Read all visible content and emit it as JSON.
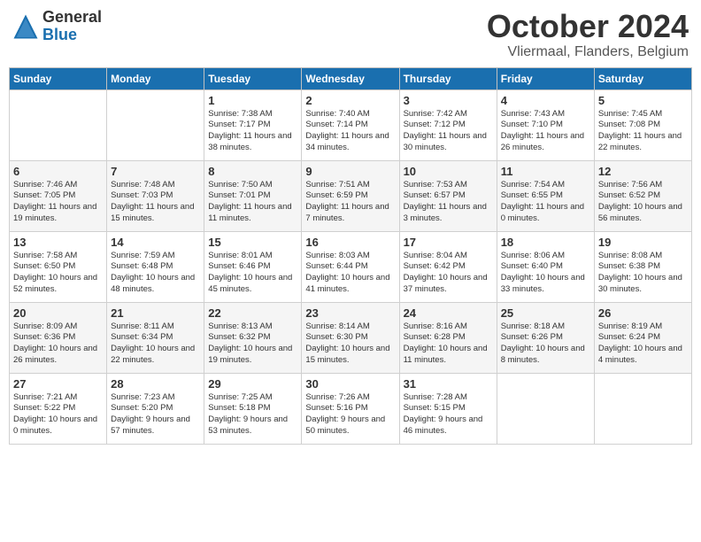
{
  "header": {
    "logo_general": "General",
    "logo_blue": "Blue",
    "month_title": "October 2024",
    "location": "Vliermaal, Flanders, Belgium"
  },
  "weekdays": [
    "Sunday",
    "Monday",
    "Tuesday",
    "Wednesday",
    "Thursday",
    "Friday",
    "Saturday"
  ],
  "weeks": [
    [
      {
        "day": "",
        "sunrise": "",
        "sunset": "",
        "daylight": ""
      },
      {
        "day": "",
        "sunrise": "",
        "sunset": "",
        "daylight": ""
      },
      {
        "day": "1",
        "sunrise": "Sunrise: 7:38 AM",
        "sunset": "Sunset: 7:17 PM",
        "daylight": "Daylight: 11 hours and 38 minutes."
      },
      {
        "day": "2",
        "sunrise": "Sunrise: 7:40 AM",
        "sunset": "Sunset: 7:14 PM",
        "daylight": "Daylight: 11 hours and 34 minutes."
      },
      {
        "day": "3",
        "sunrise": "Sunrise: 7:42 AM",
        "sunset": "Sunset: 7:12 PM",
        "daylight": "Daylight: 11 hours and 30 minutes."
      },
      {
        "day": "4",
        "sunrise": "Sunrise: 7:43 AM",
        "sunset": "Sunset: 7:10 PM",
        "daylight": "Daylight: 11 hours and 26 minutes."
      },
      {
        "day": "5",
        "sunrise": "Sunrise: 7:45 AM",
        "sunset": "Sunset: 7:08 PM",
        "daylight": "Daylight: 11 hours and 22 minutes."
      }
    ],
    [
      {
        "day": "6",
        "sunrise": "Sunrise: 7:46 AM",
        "sunset": "Sunset: 7:05 PM",
        "daylight": "Daylight: 11 hours and 19 minutes."
      },
      {
        "day": "7",
        "sunrise": "Sunrise: 7:48 AM",
        "sunset": "Sunset: 7:03 PM",
        "daylight": "Daylight: 11 hours and 15 minutes."
      },
      {
        "day": "8",
        "sunrise": "Sunrise: 7:50 AM",
        "sunset": "Sunset: 7:01 PM",
        "daylight": "Daylight: 11 hours and 11 minutes."
      },
      {
        "day": "9",
        "sunrise": "Sunrise: 7:51 AM",
        "sunset": "Sunset: 6:59 PM",
        "daylight": "Daylight: 11 hours and 7 minutes."
      },
      {
        "day": "10",
        "sunrise": "Sunrise: 7:53 AM",
        "sunset": "Sunset: 6:57 PM",
        "daylight": "Daylight: 11 hours and 3 minutes."
      },
      {
        "day": "11",
        "sunrise": "Sunrise: 7:54 AM",
        "sunset": "Sunset: 6:55 PM",
        "daylight": "Daylight: 11 hours and 0 minutes."
      },
      {
        "day": "12",
        "sunrise": "Sunrise: 7:56 AM",
        "sunset": "Sunset: 6:52 PM",
        "daylight": "Daylight: 10 hours and 56 minutes."
      }
    ],
    [
      {
        "day": "13",
        "sunrise": "Sunrise: 7:58 AM",
        "sunset": "Sunset: 6:50 PM",
        "daylight": "Daylight: 10 hours and 52 minutes."
      },
      {
        "day": "14",
        "sunrise": "Sunrise: 7:59 AM",
        "sunset": "Sunset: 6:48 PM",
        "daylight": "Daylight: 10 hours and 48 minutes."
      },
      {
        "day": "15",
        "sunrise": "Sunrise: 8:01 AM",
        "sunset": "Sunset: 6:46 PM",
        "daylight": "Daylight: 10 hours and 45 minutes."
      },
      {
        "day": "16",
        "sunrise": "Sunrise: 8:03 AM",
        "sunset": "Sunset: 6:44 PM",
        "daylight": "Daylight: 10 hours and 41 minutes."
      },
      {
        "day": "17",
        "sunrise": "Sunrise: 8:04 AM",
        "sunset": "Sunset: 6:42 PM",
        "daylight": "Daylight: 10 hours and 37 minutes."
      },
      {
        "day": "18",
        "sunrise": "Sunrise: 8:06 AM",
        "sunset": "Sunset: 6:40 PM",
        "daylight": "Daylight: 10 hours and 33 minutes."
      },
      {
        "day": "19",
        "sunrise": "Sunrise: 8:08 AM",
        "sunset": "Sunset: 6:38 PM",
        "daylight": "Daylight: 10 hours and 30 minutes."
      }
    ],
    [
      {
        "day": "20",
        "sunrise": "Sunrise: 8:09 AM",
        "sunset": "Sunset: 6:36 PM",
        "daylight": "Daylight: 10 hours and 26 minutes."
      },
      {
        "day": "21",
        "sunrise": "Sunrise: 8:11 AM",
        "sunset": "Sunset: 6:34 PM",
        "daylight": "Daylight: 10 hours and 22 minutes."
      },
      {
        "day": "22",
        "sunrise": "Sunrise: 8:13 AM",
        "sunset": "Sunset: 6:32 PM",
        "daylight": "Daylight: 10 hours and 19 minutes."
      },
      {
        "day": "23",
        "sunrise": "Sunrise: 8:14 AM",
        "sunset": "Sunset: 6:30 PM",
        "daylight": "Daylight: 10 hours and 15 minutes."
      },
      {
        "day": "24",
        "sunrise": "Sunrise: 8:16 AM",
        "sunset": "Sunset: 6:28 PM",
        "daylight": "Daylight: 10 hours and 11 minutes."
      },
      {
        "day": "25",
        "sunrise": "Sunrise: 8:18 AM",
        "sunset": "Sunset: 6:26 PM",
        "daylight": "Daylight: 10 hours and 8 minutes."
      },
      {
        "day": "26",
        "sunrise": "Sunrise: 8:19 AM",
        "sunset": "Sunset: 6:24 PM",
        "daylight": "Daylight: 10 hours and 4 minutes."
      }
    ],
    [
      {
        "day": "27",
        "sunrise": "Sunrise: 7:21 AM",
        "sunset": "Sunset: 5:22 PM",
        "daylight": "Daylight: 10 hours and 0 minutes."
      },
      {
        "day": "28",
        "sunrise": "Sunrise: 7:23 AM",
        "sunset": "Sunset: 5:20 PM",
        "daylight": "Daylight: 9 hours and 57 minutes."
      },
      {
        "day": "29",
        "sunrise": "Sunrise: 7:25 AM",
        "sunset": "Sunset: 5:18 PM",
        "daylight": "Daylight: 9 hours and 53 minutes."
      },
      {
        "day": "30",
        "sunrise": "Sunrise: 7:26 AM",
        "sunset": "Sunset: 5:16 PM",
        "daylight": "Daylight: 9 hours and 50 minutes."
      },
      {
        "day": "31",
        "sunrise": "Sunrise: 7:28 AM",
        "sunset": "Sunset: 5:15 PM",
        "daylight": "Daylight: 9 hours and 46 minutes."
      },
      {
        "day": "",
        "sunrise": "",
        "sunset": "",
        "daylight": ""
      },
      {
        "day": "",
        "sunrise": "",
        "sunset": "",
        "daylight": ""
      }
    ]
  ]
}
